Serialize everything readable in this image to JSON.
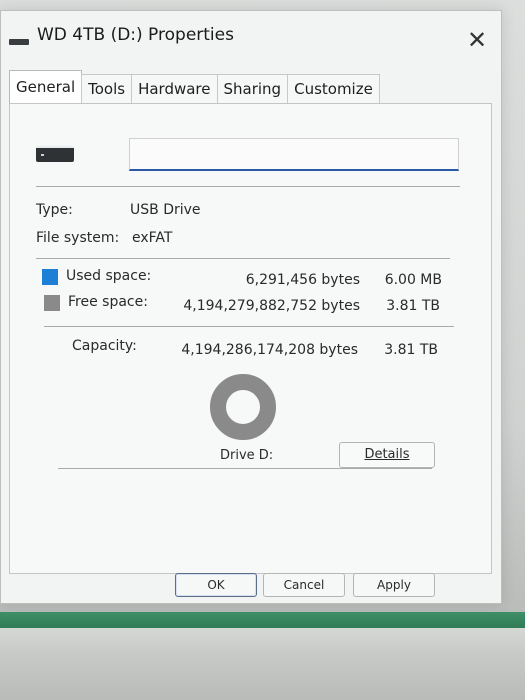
{
  "window": {
    "title": "WD 4TB (D:) Properties",
    "close_symbol": "✕"
  },
  "tabs": [
    {
      "label": "General",
      "active": true
    },
    {
      "label": "Tools",
      "active": false
    },
    {
      "label": "Hardware",
      "active": false
    },
    {
      "label": "Sharing",
      "active": false
    },
    {
      "label": "Customize",
      "active": false
    }
  ],
  "general": {
    "volume_name_value": "",
    "type_label": "Type:",
    "type_value": "USB Drive",
    "filesystem_label": "File system:",
    "filesystem_value": "exFAT",
    "used": {
      "label": "Used space:",
      "bytes": "6,291,456 bytes",
      "size": "6.00 MB",
      "color": "#1e7fd6"
    },
    "free": {
      "label": "Free space:",
      "bytes": "4,194,279,882,752 bytes",
      "size": "3.81 TB",
      "color": "#8a8a8a"
    },
    "capacity": {
      "label": "Capacity:",
      "bytes": "4,194,286,174,208 bytes",
      "size": "3.81 TB"
    },
    "drive_label": "Drive D:",
    "details_button": "Details",
    "usage_fraction": 1.5e-06
  },
  "buttons": {
    "ok": "OK",
    "cancel": "Cancel",
    "apply": "Apply"
  },
  "icons": {
    "title_icon": "drive-icon",
    "main_icon": "drive-icon",
    "close": "close-icon"
  }
}
